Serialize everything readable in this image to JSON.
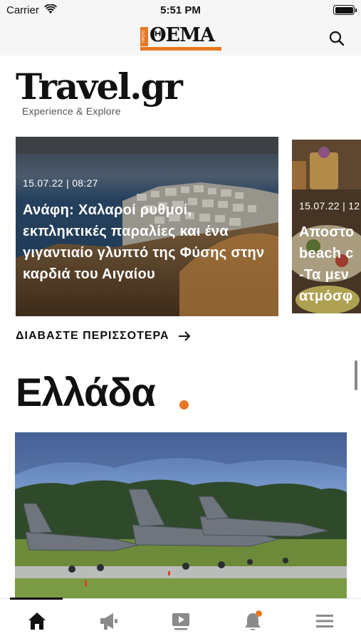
{
  "status_bar": {
    "carrier": "Carrier",
    "time": "5:51 PM"
  },
  "header": {
    "logo_text": "ΘΕΜΑ",
    "logo_tag": "ΠΡΩΤΟ",
    "search_icon": "search-icon"
  },
  "travel": {
    "title": "Travel.gr",
    "subtitle": "Experience & Explore",
    "cards": [
      {
        "meta": "15.07.22 | 08:27",
        "headline": "Ανάφη: Χαλαροί ρυθμοί, εκπληκτικές παραλίες και ένα γιγαντιαίο γλυπτό της Φύσης στην καρδιά του Αιγαίου"
      },
      {
        "meta": "15.07.22 | 12",
        "headline_lines": [
          "Αποστο",
          "beach c",
          "-Τα μεν",
          "ατμόσφ"
        ]
      }
    ],
    "read_more": "ΔΙΑΒΑΣΤΕ ΠΕΡΙΣΣΟΤΕΡΑ"
  },
  "section": {
    "title": "Ελλάδα"
  },
  "tabbar": {
    "items": [
      {
        "icon": "home-icon",
        "active": true
      },
      {
        "icon": "megaphone-icon",
        "active": false
      },
      {
        "icon": "video-icon",
        "active": false
      },
      {
        "icon": "bell-icon",
        "active": false,
        "badge": true
      },
      {
        "icon": "menu-icon",
        "active": false
      }
    ]
  },
  "colors": {
    "accent": "#e87722",
    "text": "#111111",
    "header_bg": "#f6f6f6"
  }
}
